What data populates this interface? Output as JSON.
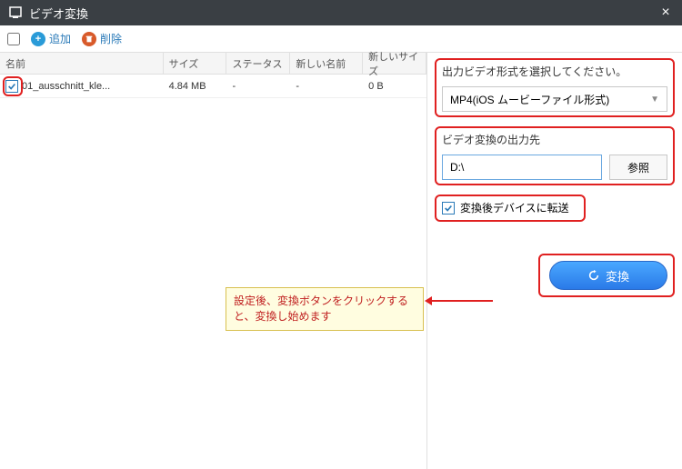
{
  "titlebar": {
    "title": "ビデオ変換"
  },
  "toolbar": {
    "add": "追加",
    "delete": "削除"
  },
  "table": {
    "headers": {
      "name": "名前",
      "size": "サイズ",
      "status": "ステータス",
      "newname": "新しい名前",
      "newsize": "新しいサイズ"
    },
    "rows": [
      {
        "checked": true,
        "name": "01_ausschnitt_kle...",
        "size": "4.84 MB",
        "status": "-",
        "newname": "-",
        "newsize": "0 B"
      }
    ]
  },
  "right": {
    "format_label": "出力ビデオ形式を選択してください。",
    "format_value": "MP4(iOS ムービーファイル形式)",
    "output_label": "ビデオ変換の出力先",
    "output_value": "D:\\",
    "browse": "参照",
    "transfer_label": "変換後デバイスに転送",
    "convert": "変換"
  },
  "callout": "設定後、変換ボタンをクリックすると、変換し始めます"
}
